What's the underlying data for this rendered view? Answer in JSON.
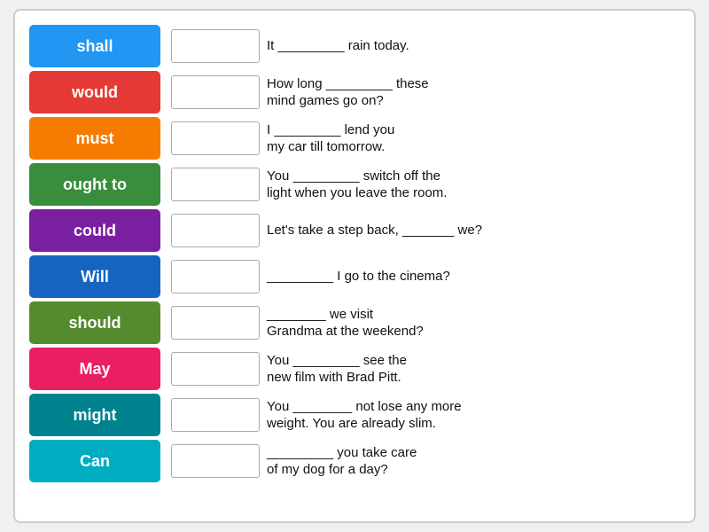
{
  "words": [
    {
      "id": "shall",
      "label": "shall",
      "color": "#2196F3"
    },
    {
      "id": "would",
      "label": "would",
      "color": "#E53935"
    },
    {
      "id": "must",
      "label": "must",
      "color": "#F57C00"
    },
    {
      "id": "ought-to",
      "label": "ought to",
      "color": "#388E3C"
    },
    {
      "id": "could",
      "label": "could",
      "color": "#7B1FA2"
    },
    {
      "id": "will",
      "label": "Will",
      "color": "#1565C0"
    },
    {
      "id": "should",
      "label": "should",
      "color": "#558B2F"
    },
    {
      "id": "may",
      "label": "May",
      "color": "#E91E63"
    },
    {
      "id": "might",
      "label": "might",
      "color": "#00838F"
    },
    {
      "id": "can",
      "label": "Can",
      "color": "#00ACC1"
    }
  ],
  "sentences": [
    {
      "id": "s1",
      "text": "It _________ rain today."
    },
    {
      "id": "s2",
      "text": "How long _________ these\nmind games go on?"
    },
    {
      "id": "s3",
      "text": "I _________ lend you\nmy car till tomorrow."
    },
    {
      "id": "s4",
      "text": "You _________ switch off the\nlight when you leave the room."
    },
    {
      "id": "s5",
      "text": "Let's take a step back, _______ we?"
    },
    {
      "id": "s6",
      "text": "_________ I go to the cinema?"
    },
    {
      "id": "s7",
      "text": "________ we visit\nGrandma at the weekend?"
    },
    {
      "id": "s8",
      "text": "You _________ see the\nnew film with Brad Pitt."
    },
    {
      "id": "s9",
      "text": "You ________ not lose any more\nweight. You are already slim."
    },
    {
      "id": "s10",
      "text": "_________ you take care\nof my dog for a day?"
    }
  ]
}
